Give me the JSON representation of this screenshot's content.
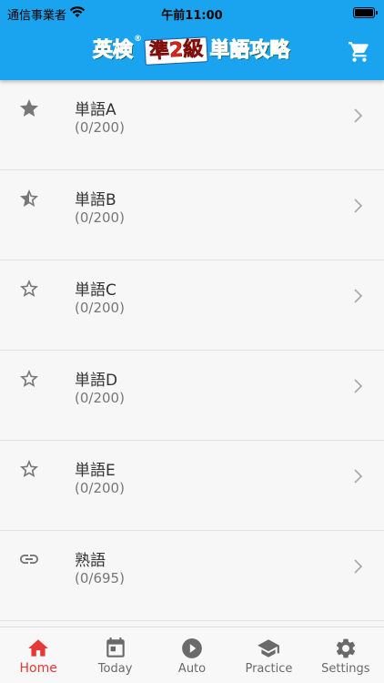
{
  "status": {
    "carrier": "通信事業者",
    "time": "午前11:00"
  },
  "header": {
    "logo": {
      "part1": "英検",
      "reg": "®",
      "part2": "準2級",
      "part3": "単語攻略"
    },
    "cart_icon": "cart-icon"
  },
  "list": [
    {
      "title": "単語A",
      "progress": "(0/200)",
      "icon": "star-filled-icon"
    },
    {
      "title": "単語B",
      "progress": "(0/200)",
      "icon": "star-half-icon"
    },
    {
      "title": "単語C",
      "progress": "(0/200)",
      "icon": "star-outline-icon"
    },
    {
      "title": "単語D",
      "progress": "(0/200)",
      "icon": "star-outline-icon"
    },
    {
      "title": "単語E",
      "progress": "(0/200)",
      "icon": "star-outline-icon"
    },
    {
      "title": "熟語",
      "progress": "(0/695)",
      "icon": "link-icon"
    }
  ],
  "tabs": [
    {
      "label": "Home",
      "icon": "home-icon",
      "active": true
    },
    {
      "label": "Today",
      "icon": "calendar-icon"
    },
    {
      "label": "Auto",
      "icon": "play-icon"
    },
    {
      "label": "Practice",
      "icon": "school-icon"
    },
    {
      "label": "Settings",
      "icon": "gear-icon"
    }
  ],
  "colors": {
    "header": "#1aa3ee",
    "active_tab": "#e53935",
    "icon_gray": "#777777"
  }
}
